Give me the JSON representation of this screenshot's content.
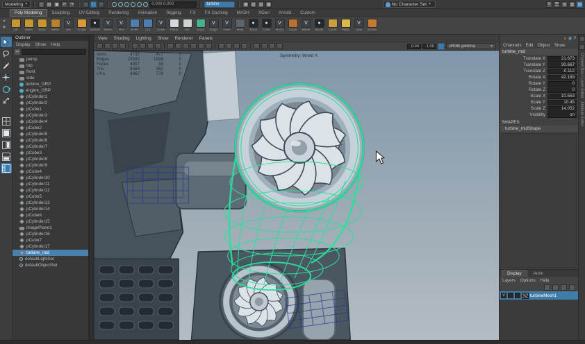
{
  "colors": {
    "accent_blue": "#3e79a8",
    "selection_row": "#4a80ad",
    "wireframe_green": "#2be09c",
    "template_blue": "#25388c",
    "viewport_top": "#8097ab",
    "viewport_bottom": "#b3bcc2"
  },
  "status_line": {
    "menuset": "Modeling",
    "coord_field": "0.000 0.000",
    "quick_field": "turbine",
    "character_set": "No Character Set",
    "icons": [
      "file-new-icon",
      "file-open-icon",
      "file-save-icon",
      "undo-icon",
      "redo-icon",
      "snap-grid-icon",
      "snap-curve-icon",
      "snap-point-icon",
      "selection-mask-hierarchy-icon",
      "selection-mask-object-icon",
      "selection-mask-component-icon",
      "render-icon",
      "ipr-render-icon",
      "render-settings-icon",
      "sidebar-attribute-editor-icon",
      "sidebar-tool-settings-icon",
      "sidebar-channelbox-icon"
    ]
  },
  "shelf": {
    "tabs": [
      {
        "t": "Poly Modeling",
        "cls": "active"
      },
      {
        "t": "Sculpting",
        "cls": ""
      },
      {
        "t": "UV Editing",
        "cls": ""
      },
      {
        "t": "Rendering",
        "cls": ""
      },
      {
        "t": "Animation",
        "cls": ""
      },
      {
        "t": "Rigging",
        "cls": ""
      },
      {
        "t": "FX",
        "cls": ""
      },
      {
        "t": "FX Caching",
        "cls": ""
      },
      {
        "t": "MASH",
        "cls": ""
      },
      {
        "t": "XGen",
        "cls": ""
      },
      {
        "t": "Arnold",
        "cls": ""
      },
      {
        "t": "Custom",
        "cls": ""
      }
    ],
    "icons": [
      {
        "s": "background:#c8962f",
        "g": "",
        "l": "Lift"
      },
      {
        "s": "background:#c8962f",
        "g": "",
        "l": "Open"
      },
      {
        "s": "background:#c8962f",
        "g": "",
        "l": "Save"
      },
      {
        "s": "background:#b5842a",
        "g": "",
        "l": "Mesh"
      },
      {
        "s": "background:#3b4147",
        "g": "V",
        "l": "Vtx"
      },
      {
        "s": "background:#d89a3a",
        "g": "",
        "l": "Sculpt"
      },
      {
        "s": "background:#23282d",
        "g": "●",
        "l": "Sphere"
      },
      {
        "s": "background:#3b4147",
        "g": "V",
        "l": "Move"
      },
      {
        "s": "background:#3b4147",
        "g": "V",
        "l": "Rot"
      },
      {
        "s": "background:#4c7fb0",
        "g": "",
        "l": "Knife"
      },
      {
        "s": "background:#4c7fb0",
        "g": "",
        "l": "Cut"
      },
      {
        "s": "background:#3b4147",
        "g": "V",
        "l": "Scale"
      },
      {
        "s": "background:#d4d8db",
        "g": "",
        "l": "Plane"
      },
      {
        "s": "background:#cfd3d6",
        "g": "",
        "l": "UV"
      },
      {
        "s": "background:#47b189",
        "g": "",
        "l": "Quad"
      },
      {
        "s": "background:#3b4147",
        "g": "V",
        "l": "Edge"
      },
      {
        "s": "background:#3b4147",
        "g": "V",
        "l": "Face"
      },
      {
        "s": "background:#5b646c",
        "g": "",
        "l": "Multi"
      },
      {
        "s": "background:#23282d",
        "g": "●",
        "l": "Torus"
      },
      {
        "s": "background:#23282d",
        "g": "●",
        "l": "Cone"
      },
      {
        "s": "background:#3b4147",
        "g": "V",
        "l": "Norm"
      },
      {
        "s": "background:#b8722d",
        "g": "",
        "l": "Curve"
      },
      {
        "s": "background:#3b4147",
        "g": "V",
        "l": "Bevel"
      },
      {
        "s": "background:#23282d",
        "g": "●",
        "l": "Boole"
      },
      {
        "s": "background:#c9a23b",
        "g": "",
        "l": "Comb"
      },
      {
        "s": "background:#d8ba4a",
        "g": "",
        "l": "Mask"
      },
      {
        "s": "background:#3b4147",
        "g": "V",
        "l": "Sew"
      },
      {
        "s": "background:#c87a2e",
        "g": "",
        "l": "Smear"
      }
    ]
  },
  "toolbox": {
    "tools": [
      "select-tool",
      "lasso-tool",
      "paint-select-tool",
      "move-tool",
      "rotate-tool",
      "scale-tool"
    ],
    "layouts": [
      "layout-single-pane",
      "layout-four-pane",
      "layout-persp-outliner",
      "layout-split-pane",
      "layout-hypershade-pane"
    ]
  },
  "outliner": {
    "title": "Outliner",
    "menus": [
      "Display",
      "Show",
      "Help"
    ],
    "search_placeholder": "",
    "items": [
      {
        "i": "i-cam",
        "t": "persp",
        "cls": ""
      },
      {
        "i": "i-cam",
        "t": "top",
        "cls": ""
      },
      {
        "i": "i-cam",
        "t": "front",
        "cls": ""
      },
      {
        "i": "i-cam",
        "t": "side",
        "cls": ""
      },
      {
        "i": "i-grp",
        "t": "turbine_GRP",
        "cls": ""
      },
      {
        "i": "i-grp",
        "t": "engine_GRP",
        "cls": ""
      },
      {
        "i": "i-mesh",
        "t": "pCylinder1",
        "cls": ""
      },
      {
        "i": "i-mesh",
        "t": "pCylinder2",
        "cls": ""
      },
      {
        "i": "i-mesh",
        "t": "pCube1",
        "cls": ""
      },
      {
        "i": "i-mesh",
        "t": "pCylinder3",
        "cls": ""
      },
      {
        "i": "i-mesh",
        "t": "pCylinder4",
        "cls": ""
      },
      {
        "i": "i-mesh",
        "t": "pCube2",
        "cls": ""
      },
      {
        "i": "i-mesh",
        "t": "pCylinder5",
        "cls": ""
      },
      {
        "i": "i-mesh",
        "t": "pCylinder6",
        "cls": ""
      },
      {
        "i": "i-mesh",
        "t": "pCylinder7",
        "cls": ""
      },
      {
        "i": "i-mesh",
        "t": "pCube3",
        "cls": ""
      },
      {
        "i": "i-mesh",
        "t": "pCylinder8",
        "cls": ""
      },
      {
        "i": "i-mesh",
        "t": "pCylinder9",
        "cls": ""
      },
      {
        "i": "i-mesh",
        "t": "pCube4",
        "cls": ""
      },
      {
        "i": "i-mesh",
        "t": "pCylinder10",
        "cls": ""
      },
      {
        "i": "i-mesh",
        "t": "pCylinder11",
        "cls": ""
      },
      {
        "i": "i-mesh",
        "t": "pCylinder12",
        "cls": ""
      },
      {
        "i": "i-mesh",
        "t": "pCube5",
        "cls": ""
      },
      {
        "i": "i-mesh",
        "t": "pCylinder13",
        "cls": ""
      },
      {
        "i": "i-mesh",
        "t": "pCylinder14",
        "cls": ""
      },
      {
        "i": "i-mesh",
        "t": "pCube6",
        "cls": ""
      },
      {
        "i": "i-mesh",
        "t": "pCylinder15",
        "cls": ""
      },
      {
        "i": "i-cam",
        "t": "imagePlane1",
        "cls": ""
      },
      {
        "i": "i-mesh",
        "t": "pCylinder16",
        "cls": ""
      },
      {
        "i": "i-mesh",
        "t": "pCube7",
        "cls": ""
      },
      {
        "i": "i-mesh",
        "t": "pCylinder17",
        "cls": ""
      },
      {
        "i": "i-mesh",
        "t": "turbine_mid",
        "cls": "selected"
      },
      {
        "i": "i-set",
        "t": "defaultLightSet",
        "cls": ""
      },
      {
        "i": "i-set",
        "t": "defaultObjectSet",
        "cls": ""
      }
    ]
  },
  "viewport": {
    "menus": [
      "View",
      "Shading",
      "Lighting",
      "Show",
      "Renderer",
      "Panels"
    ],
    "toolbar_icons": [
      "select-camera-icon",
      "lock-camera-icon",
      "camera-attributes-icon",
      "bookmark-icon",
      "image-plane-icon",
      "2d-pan-zoom-icon",
      "grease-pencil-icon",
      "grid-icon",
      "film-gate-icon",
      "resolution-gate-icon",
      "gate-mask-icon",
      "field-chart-icon",
      "safe-action-icon",
      "safe-title-icon",
      "isolate-select-icon",
      "wireframe-icon",
      "shaded-icon",
      "textured-icon",
      "use-default-material-icon",
      "xray-icon",
      "lighting-all-icon",
      "shadows-icon"
    ],
    "exposure": "0.00",
    "gamma": "1.00",
    "view_transform": "sRGB gamma",
    "symmetry_label": "Symmetry: World X",
    "hud": {
      "rows": [
        {
          "l": "Verts",
          "a": "4732",
          "b": "477",
          "c": "0"
        },
        {
          "l": "Edges",
          "a": "23930",
          "b": "1998",
          "c": "0"
        },
        {
          "l": "Faces",
          "a": "4907",
          "b": "98",
          "c": "0"
        },
        {
          "l": "Tris",
          "a": "9389",
          "b": "382",
          "c": "0"
        },
        {
          "l": "UVs",
          "a": "4967",
          "b": "778",
          "c": "0"
        }
      ]
    }
  },
  "channel_box": {
    "menus": [
      "Channels",
      "Edit",
      "Object",
      "Show"
    ],
    "object_name": "turbine_mid",
    "rows": [
      {
        "l": "Translate X",
        "v": "21.673"
      },
      {
        "l": "Translate Y",
        "v": "30.667"
      },
      {
        "l": "Translate Z",
        "v": "-0.112"
      },
      {
        "l": "Rotate X",
        "v": "42.189"
      },
      {
        "l": "Rotate Y",
        "v": "0"
      },
      {
        "l": "Rotate Z",
        "v": "0"
      },
      {
        "l": "Scale X",
        "v": "10.553"
      },
      {
        "l": "Scale Y",
        "v": "10.45"
      },
      {
        "l": "Scale Z",
        "v": "14.052"
      },
      {
        "l": "Visibility",
        "v": "on"
      }
    ],
    "shapes_header": "SHAPES",
    "shape_name": "turbine_midShape"
  },
  "layer_editor": {
    "tabs": [
      {
        "t": "Display",
        "cls": "active"
      },
      {
        "t": "Anim",
        "cls": ""
      }
    ],
    "menus": [
      "Layers",
      "Options",
      "Help"
    ],
    "layer": {
      "v": "V",
      "name": "turbineMesh1"
    }
  },
  "right_strip": {
    "labels": [
      "Channel Box / Layer Editor",
      "Attribute Editor"
    ]
  }
}
